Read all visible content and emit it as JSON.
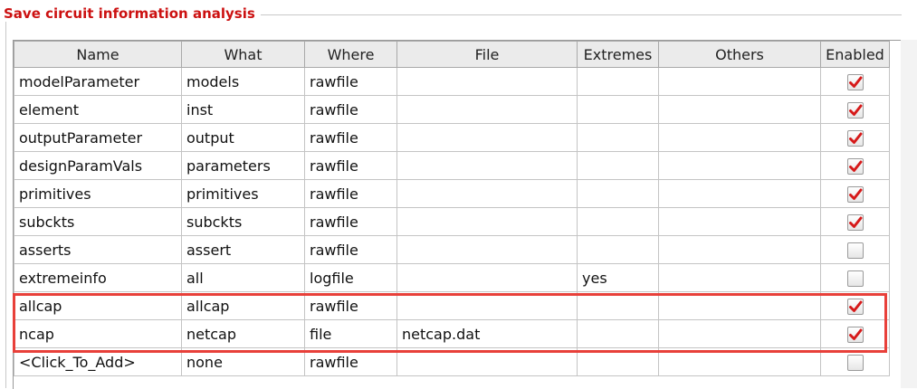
{
  "panel": {
    "title": "Save circuit information analysis"
  },
  "table": {
    "columns": [
      "Name",
      "What",
      "Where",
      "File",
      "Extremes",
      "Others",
      "Enabled"
    ],
    "rows": [
      {
        "name": "modelParameter",
        "what": "models",
        "where": "rawfile",
        "file": "",
        "extremes": "",
        "others": "",
        "enabled": true
      },
      {
        "name": "element",
        "what": "inst",
        "where": "rawfile",
        "file": "",
        "extremes": "",
        "others": "",
        "enabled": true
      },
      {
        "name": "outputParameter",
        "what": "output",
        "where": "rawfile",
        "file": "",
        "extremes": "",
        "others": "",
        "enabled": true
      },
      {
        "name": "designParamVals",
        "what": "parameters",
        "where": "rawfile",
        "file": "",
        "extremes": "",
        "others": "",
        "enabled": true
      },
      {
        "name": "primitives",
        "what": "primitives",
        "where": "rawfile",
        "file": "",
        "extremes": "",
        "others": "",
        "enabled": true
      },
      {
        "name": "subckts",
        "what": "subckts",
        "where": "rawfile",
        "file": "",
        "extremes": "",
        "others": "",
        "enabled": true
      },
      {
        "name": "asserts",
        "what": "assert",
        "where": "rawfile",
        "file": "",
        "extremes": "",
        "others": "",
        "enabled": false
      },
      {
        "name": "extremeinfo",
        "what": "all",
        "where": "logfile",
        "file": "",
        "extremes": "yes",
        "others": "",
        "enabled": false
      },
      {
        "name": "allcap",
        "what": "allcap",
        "where": "rawfile",
        "file": "",
        "extremes": "",
        "others": "",
        "enabled": true
      },
      {
        "name": "ncap",
        "what": "netcap",
        "where": "file",
        "file": "netcap.dat",
        "extremes": "",
        "others": "",
        "enabled": true
      },
      {
        "name": "<Click_To_Add>",
        "what": "none",
        "where": "rawfile",
        "file": "",
        "extremes": "",
        "others": "",
        "enabled": false
      }
    ]
  },
  "colors": {
    "title": "#cc1111",
    "check": "#d61a1a",
    "highlight": "#e8403a"
  },
  "icons": {
    "checked": "red-checkmark-icon"
  }
}
